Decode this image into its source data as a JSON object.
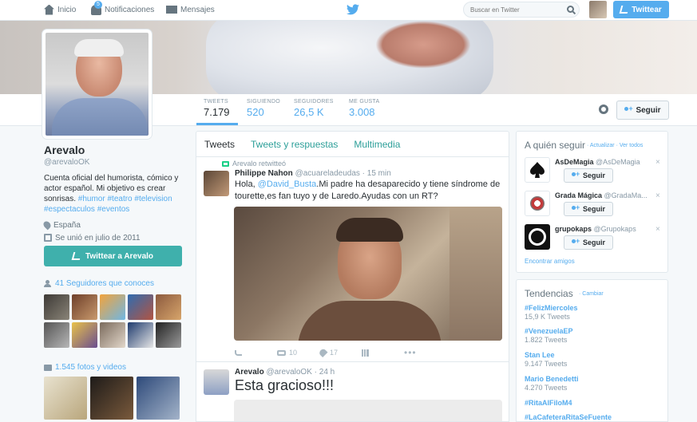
{
  "colors": {
    "accent": "#55acee",
    "teal": "#3fb0ac",
    "text": "#292f33",
    "muted": "#8899a6"
  },
  "topbar": {
    "home_label": "Inicio",
    "notifications_label": "Notificaciones",
    "notifications_badge": "5",
    "messages_label": "Mensajes",
    "search_placeholder": "Buscar en Twitter",
    "tweet_button_label": "Twittear"
  },
  "profile_nav": {
    "stats": [
      {
        "label": "TWEETS",
        "value": "7.179"
      },
      {
        "label": "SIGUIENDO",
        "value": "520"
      },
      {
        "label": "SEGUIDORES",
        "value": "26,5 K"
      },
      {
        "label": "ME GUSTA",
        "value": "3.008"
      }
    ],
    "follow_label": "Seguir"
  },
  "profile": {
    "name": "Arevalo",
    "handle": "@arevaloOK",
    "bio_text": "Cuenta oficial del humorista, cómico y actor español. Mi objetivo es crear sonrisas.",
    "bio_tags_line1": "#humor #teatro #television",
    "bio_tags_line2": "#espectaculos #eventos",
    "location": "España",
    "joined": "Se unió en julio de 2011",
    "tweet_to_label": "Twittear a Arevalo",
    "followers_known": "41 Seguidores que conoces",
    "photos_label": "1.545 fotos y videos"
  },
  "timeline": {
    "tabs": [
      "Tweets",
      "Tweets y respuestas",
      "Multimedia"
    ],
    "tweet1": {
      "retweet_label": "Arevalo retwitteó",
      "name": "Philippe Nahon",
      "handle": "@acuareladeudas",
      "time": "· 15 min",
      "text_before": "Hola, ",
      "mention": "@David_Busta",
      "text_after": ".Mi padre ha desaparecido y tiene síndrome de tourette,es fan tuyo y de Laredo.Ayudas con un RT?",
      "retweets": "10",
      "likes": "17",
      "more": "•••"
    },
    "tweet2": {
      "name": "Arevalo",
      "handle": "@arevaloOK",
      "time": "· 24 h",
      "text": "Esta gracioso!!!"
    }
  },
  "who_to_follow": {
    "title": "A quién seguir",
    "links": "· Actualizar · Ver todos",
    "follow_label": "Seguir",
    "close": "×",
    "items": [
      {
        "name": "AsDeMagia",
        "handle": "@AsDeMagia"
      },
      {
        "name": "Grada Mágica",
        "handle": "@GradaMa..."
      },
      {
        "name": "grupokaps",
        "handle": "@Grupokaps"
      }
    ],
    "find_friends": "Encontrar amigos"
  },
  "trends": {
    "title": "Tendencias",
    "change": "· Cambiar",
    "items": [
      {
        "name": "#FelizMiercoles",
        "count": "15,9 K Tweets"
      },
      {
        "name": "#VenezuelaEP",
        "count": "1.822 Tweets"
      },
      {
        "name": "Stan Lee",
        "count": "9.147 Tweets"
      },
      {
        "name": "Mario Benedetti",
        "count": "4.270 Tweets"
      },
      {
        "name": "#RitaAlFiloM4",
        "count": ""
      },
      {
        "name": "#LaCafeteraRitaSeFuente",
        "count": ""
      }
    ]
  }
}
